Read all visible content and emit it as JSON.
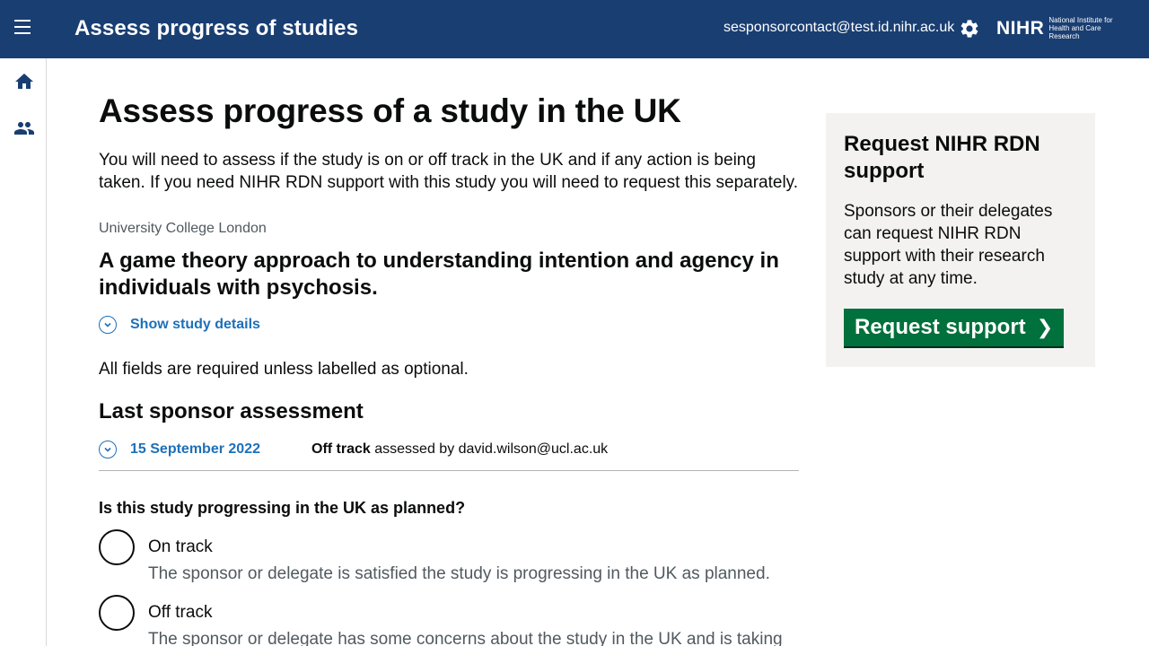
{
  "header": {
    "app_title": "Assess progress of studies",
    "user_email": "sesponsorcontact@test.id.nihr.ac.uk",
    "logo_word": "NIHR",
    "logo_sub": "National Institute for Health and Care Research",
    "icons": [
      "menu-icon",
      "gear-icon"
    ]
  },
  "sidenav": {
    "icons": [
      "home-icon",
      "people-icon"
    ]
  },
  "main": {
    "heading": "Assess progress of a study in the UK",
    "intro": "You will need to assess if the study is on or off track in the UK and if any action is being taken. If you need NIHR RDN support with this study you will need to request this separately.",
    "organisation": "University College London",
    "study_title": "A game theory approach to understanding intention and agency in individuals with psychosis.",
    "show_details": "Show study details",
    "required_note": "All fields are required unless labelled as optional.",
    "last_assessment_heading": "Last sponsor assessment",
    "last_assessment": {
      "date": "15 September 2022",
      "status": "Off track",
      "assessed_by": "assessed by david.wilson@ucl.ac.uk"
    },
    "question": "Is this study progressing in the UK as planned?",
    "options": [
      {
        "label": "On track",
        "hint": "The sponsor or delegate is satisfied the study is progressing in the UK as planned."
      },
      {
        "label": "Off track",
        "hint": "The sponsor or delegate has some concerns about the study in the UK and is taking"
      }
    ]
  },
  "aside": {
    "title": "Request NIHR RDN support",
    "body": "Sponsors or their delegates can request NIHR RDN support with their research study at any time.",
    "button": "Request support"
  },
  "colors": {
    "header_bg": "#193e72",
    "link": "#1d70b8",
    "button": "#00703c",
    "panel": "#f3f2f1"
  }
}
